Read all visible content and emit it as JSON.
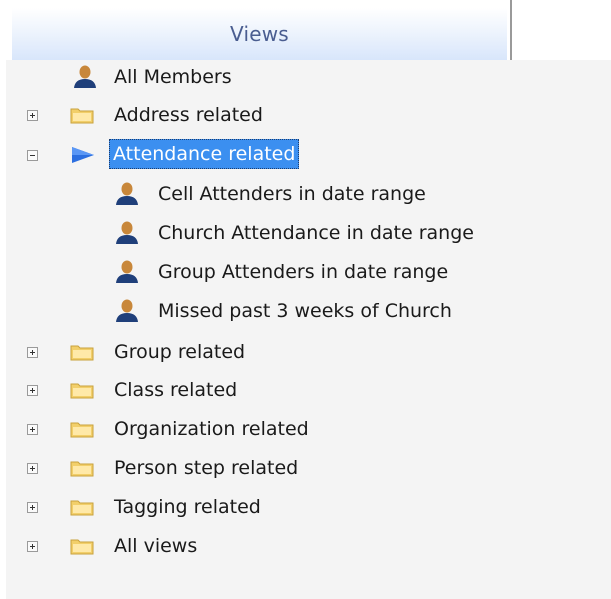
{
  "panel": {
    "title": "Views"
  },
  "tree": {
    "all_members": "All Members",
    "address_related": "Address related",
    "attendance_related": "Attendance related",
    "attendance_children": [
      "Cell Attenders in date range",
      "Church Attendance in date range",
      "Group Attenders in date range",
      "Missed past 3 weeks of Church"
    ],
    "group_related": "Group related",
    "class_related": "Class related",
    "organization_related": "Organization related",
    "person_step_related": "Person step related",
    "tagging_related": "Tagging related",
    "all_views": "All views"
  },
  "icons": {
    "expand": "plus-box-icon",
    "collapse": "minus-box-icon",
    "folder": "folder-icon",
    "user": "user-icon",
    "selected_node": "blue-arrow-icon"
  },
  "colors": {
    "header_text": "#4a5d90",
    "selection_bg": "#3b8ff0",
    "selection_text": "#ffffff",
    "tree_bg": "#f4f4f4"
  }
}
